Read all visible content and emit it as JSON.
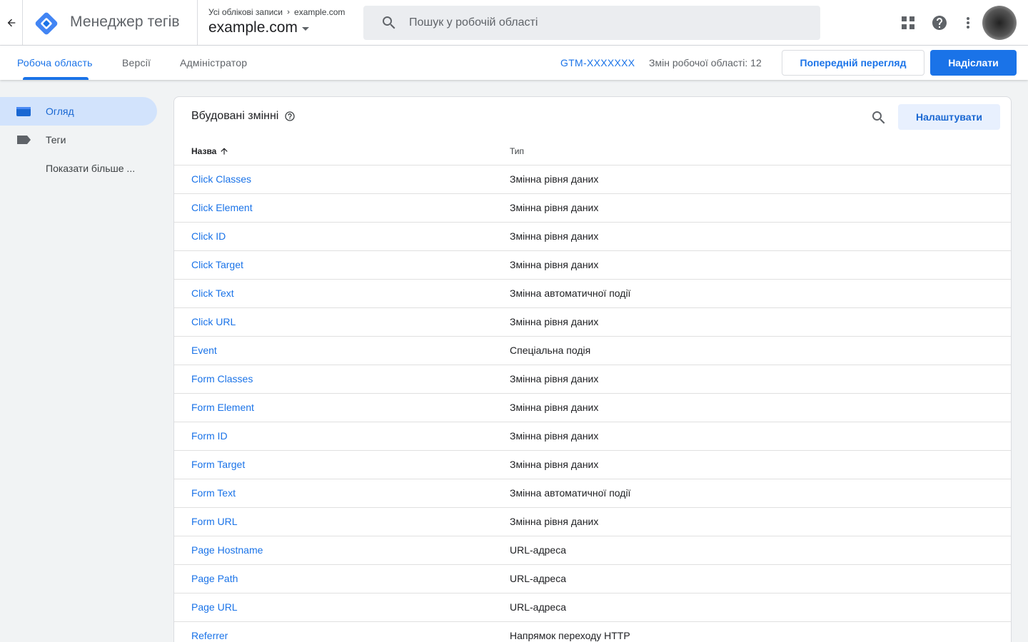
{
  "header": {
    "product_name": "Менеджер тегів",
    "breadcrumb_all_accounts": "Усі облікові записи",
    "breadcrumb_account": "example.com",
    "container_name": "example.com",
    "search_placeholder": "Пошук у робочій області"
  },
  "subnav": {
    "tabs": [
      {
        "label": "Робоча область",
        "active": true
      },
      {
        "label": "Версії",
        "active": false
      },
      {
        "label": "Адміністратор",
        "active": false
      }
    ],
    "container_id": "GTM-XXXXXXX",
    "workspace_changes": "Змін робочої області: 12",
    "preview_label": "Попередній перегляд",
    "submit_label": "Надіслати"
  },
  "sidebar": {
    "items": [
      {
        "label": "Огляд",
        "icon": "overview-folder-icon",
        "active": true
      },
      {
        "label": "Теги",
        "icon": "tag-icon",
        "active": false
      },
      {
        "label": "Показати більше ...",
        "icon": "",
        "active": false
      }
    ]
  },
  "card": {
    "title": "Вбудовані змінні",
    "configure_label": "Налаштувати",
    "col_name": "Назва",
    "col_type": "Тип",
    "rows": [
      {
        "name": "Click Classes",
        "type": "Змінна рівня даних"
      },
      {
        "name": "Click Element",
        "type": "Змінна рівня даних"
      },
      {
        "name": "Click ID",
        "type": "Змінна рівня даних"
      },
      {
        "name": "Click Target",
        "type": "Змінна рівня даних"
      },
      {
        "name": "Click Text",
        "type": "Змінна автоматичної події"
      },
      {
        "name": "Click URL",
        "type": "Змінна рівня даних"
      },
      {
        "name": "Event",
        "type": "Спеціальна подія"
      },
      {
        "name": "Form Classes",
        "type": "Змінна рівня даних"
      },
      {
        "name": "Form Element",
        "type": "Змінна рівня даних"
      },
      {
        "name": "Form ID",
        "type": "Змінна рівня даних"
      },
      {
        "name": "Form Target",
        "type": "Змінна рівня даних"
      },
      {
        "name": "Form Text",
        "type": "Змінна автоматичної події"
      },
      {
        "name": "Form URL",
        "type": "Змінна рівня даних"
      },
      {
        "name": "Page Hostname",
        "type": "URL-адреса"
      },
      {
        "name": "Page Path",
        "type": "URL-адреса"
      },
      {
        "name": "Page URL",
        "type": "URL-адреса"
      },
      {
        "name": "Referrer",
        "type": "Напрямок переходу HTTP"
      }
    ]
  },
  "colors": {
    "accent": "#1a73e8",
    "active_nav_bg": "#d2e3fc"
  }
}
